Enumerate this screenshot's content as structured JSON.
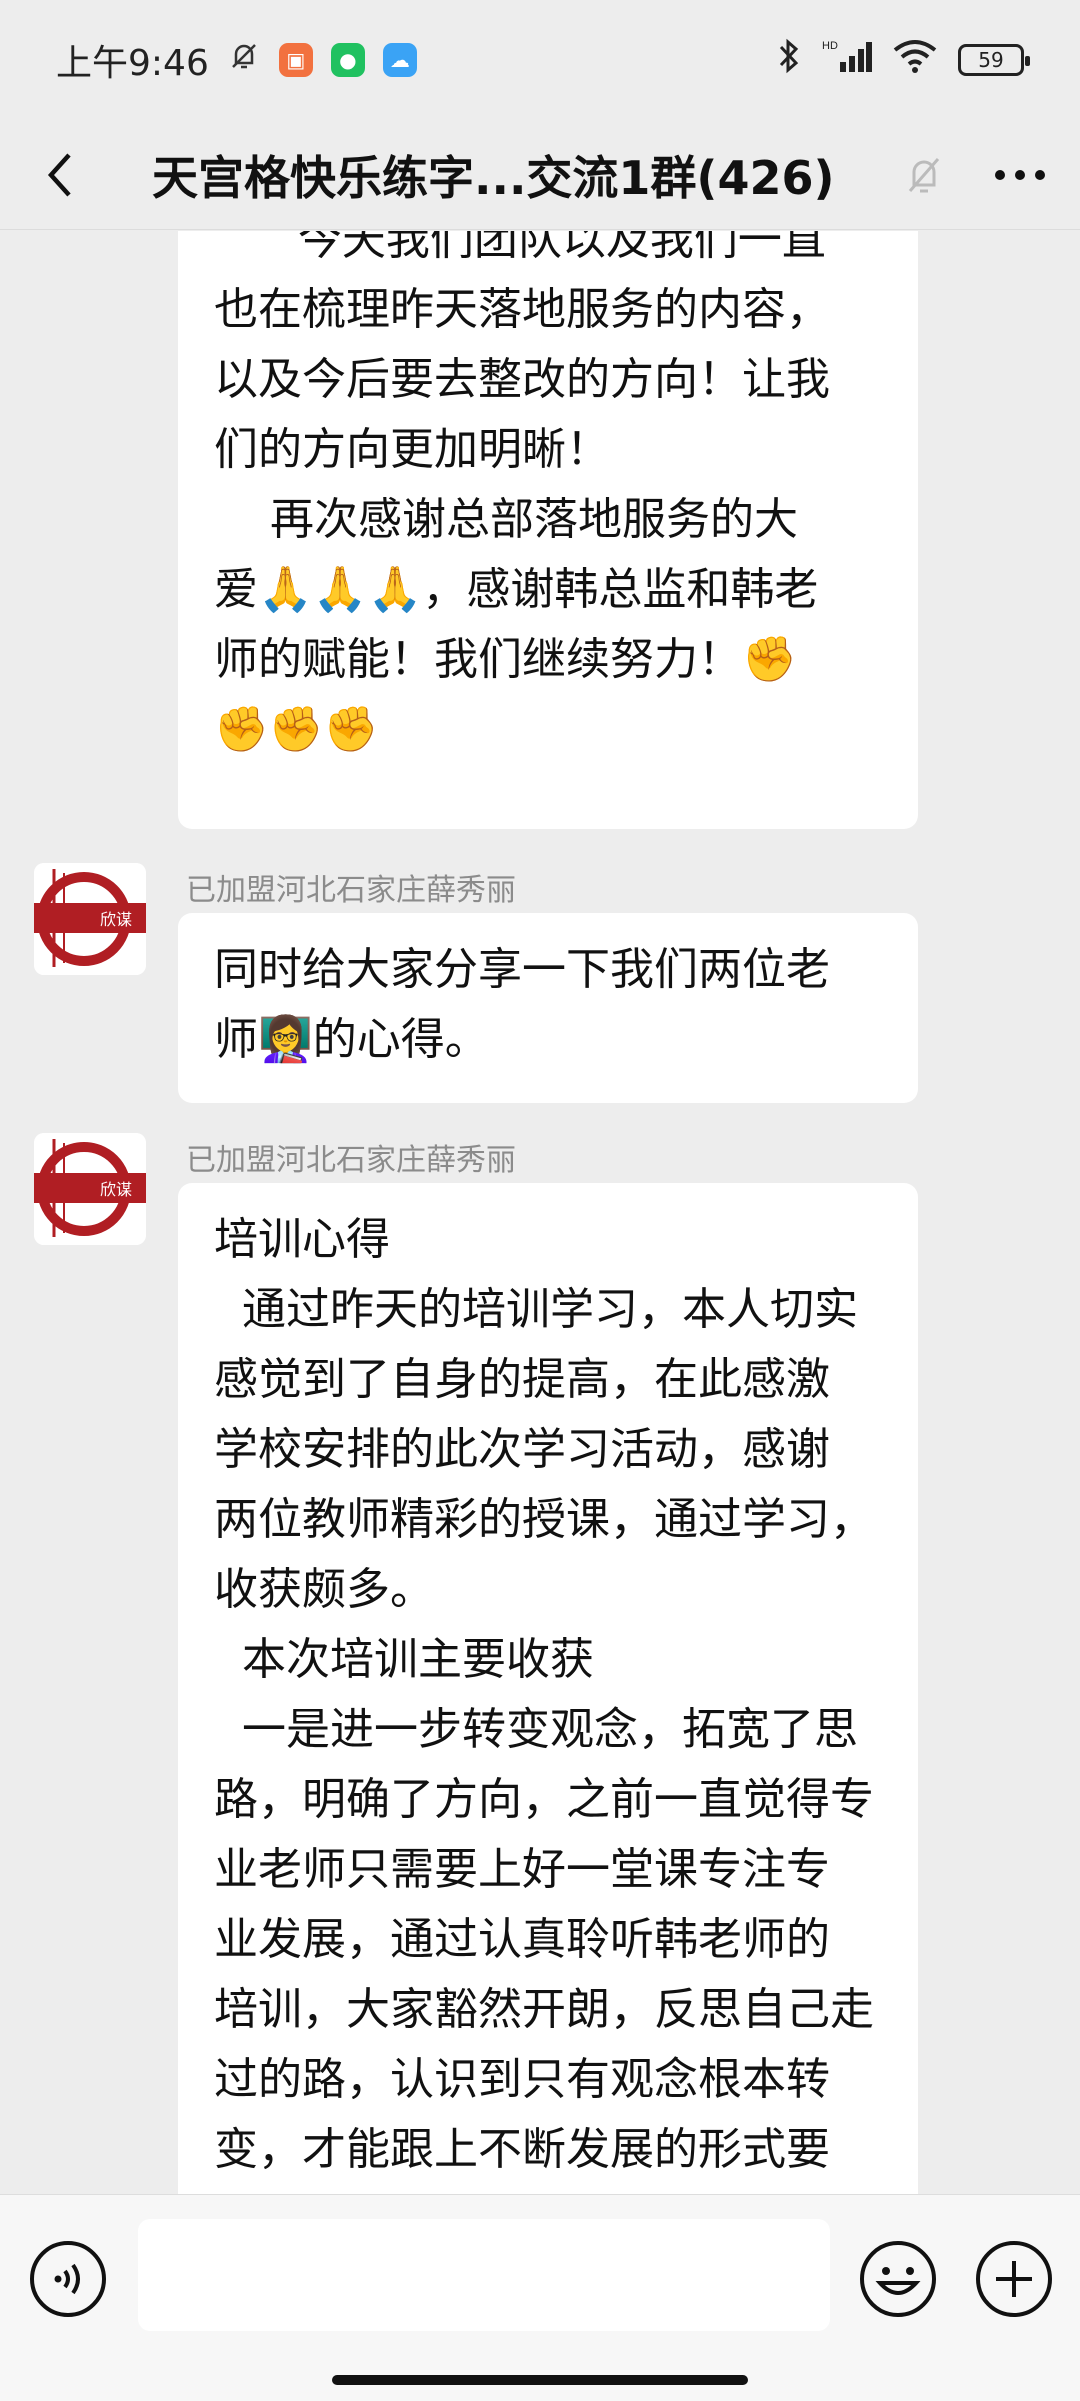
{
  "status": {
    "time": "上午9:46",
    "battery": "59"
  },
  "header": {
    "title": "天宫格快乐练字...交流1群(426)"
  },
  "messages": [
    {
      "text": "      今天我们团队以及我们一直\n也在梳理昨天落地服务的内容，\n以及今后要去整改的方向！让我\n们的方向更加明晰！\n    再次感谢总部落地服务的大\n爱🙏🙏🙏，感谢韩总监和韩老\n师的赋能！我们继续努力！✊\n✊✊✊"
    },
    {
      "sender": "已加盟河北石家庄薛秀丽",
      "text": "同时给大家分享一下我们两位老\n师👩‍🏫的心得。"
    },
    {
      "sender": "已加盟河北石家庄薛秀丽",
      "text": "培训心得\n  通过昨天的培训学习，本人切实\n感觉到了自身的提高，在此感激\n学校安排的此次学习活动，感谢\n两位教师精彩的授课，通过学习，\n收获颇多。\n  本次培训主要收获\n  一是进一步转变观念，拓宽了思\n路，明确了方向，之前一直觉得专\n业老师只需要上好一堂课专注专\n业发展，通过认真聆听韩老师的\n培训，大家豁然开朗，反思自己走\n过的路，认识到只有观念根本转\n变，才能跟上不断发展的形式要"
    }
  ],
  "avatar": {
    "logo_text": "欣谋"
  }
}
